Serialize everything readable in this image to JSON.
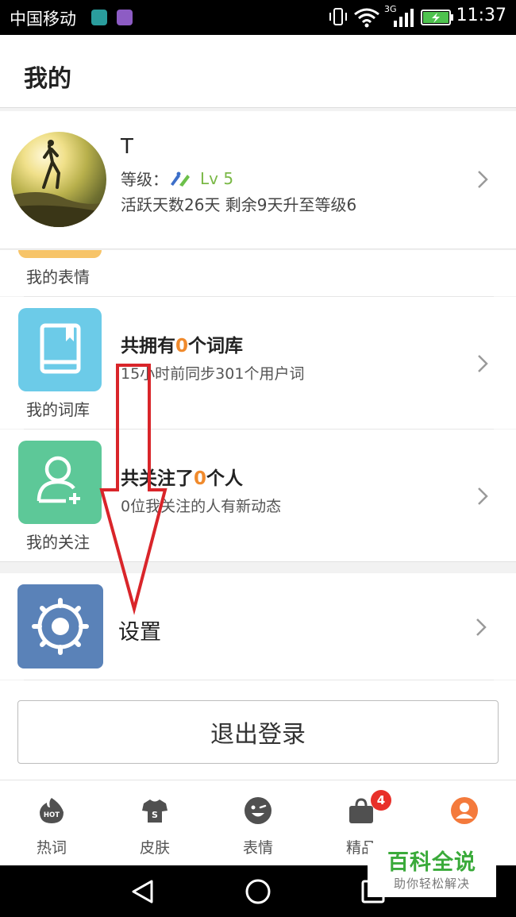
{
  "status_bar": {
    "carrier": "中国移动",
    "network": "3G",
    "time": "11:37"
  },
  "header": {
    "title": "我的"
  },
  "profile": {
    "name": "T",
    "level_label": "等级：",
    "level_value": "Lv 5",
    "active_text": "活跃天数26天 剩余9天升至等级6"
  },
  "sections": {
    "emoji": {
      "label": "我的表情"
    },
    "lexicon": {
      "label": "我的词库",
      "title_pre": "共拥有",
      "count": "0",
      "title_post": "个词库",
      "subtitle": "15小时前同步301个用户词"
    },
    "follow": {
      "label": "我的关注",
      "title_pre": "共关注了",
      "count": "0",
      "title_post": "个人",
      "subtitle": "0位我关注的人有新动态"
    },
    "settings": {
      "label": "设置"
    }
  },
  "logout": {
    "label": "退出登录"
  },
  "tabs": [
    {
      "label": "热词",
      "icon": "hot-icon",
      "icon_text": "HOT"
    },
    {
      "label": "皮肤",
      "icon": "tshirt-icon",
      "icon_text": "S"
    },
    {
      "label": "表情",
      "icon": "emoji-icon"
    },
    {
      "label": "精品",
      "icon": "bag-icon",
      "badge": "4"
    },
    {
      "label": "",
      "icon": "user-icon",
      "active": true
    }
  ],
  "watermark": {
    "title": "百科全说",
    "subtitle": "助你轻松解决"
  },
  "colors": {
    "accent_orange": "#f08a2c",
    "level_green": "#7ab846",
    "lexicon_tile": "#6ccbe8",
    "follow_tile": "#5dc898",
    "settings_tile": "#5a82b8",
    "badge_red": "#e8302a",
    "annotation_red": "#d9252a"
  }
}
